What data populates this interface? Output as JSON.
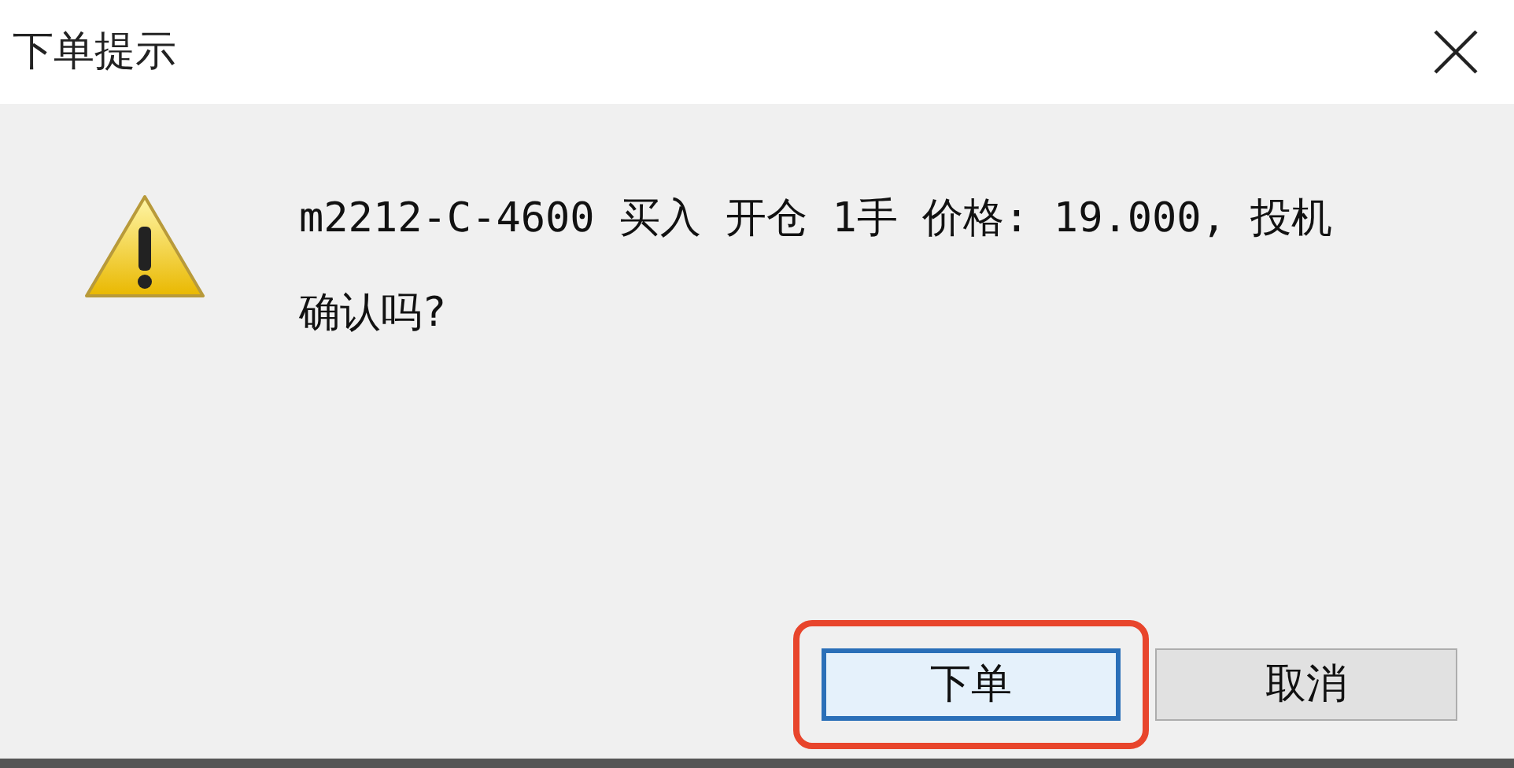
{
  "window": {
    "title": "下单提示"
  },
  "message": {
    "lines": [
      "m2212-C-4600 买入 开仓 1手 价格: 19.000, 投机",
      "确认吗?"
    ]
  },
  "buttons": [
    {
      "label": "下单",
      "default": true,
      "highlighted": true
    },
    {
      "label": "取消",
      "default": false,
      "highlighted": false
    }
  ]
}
